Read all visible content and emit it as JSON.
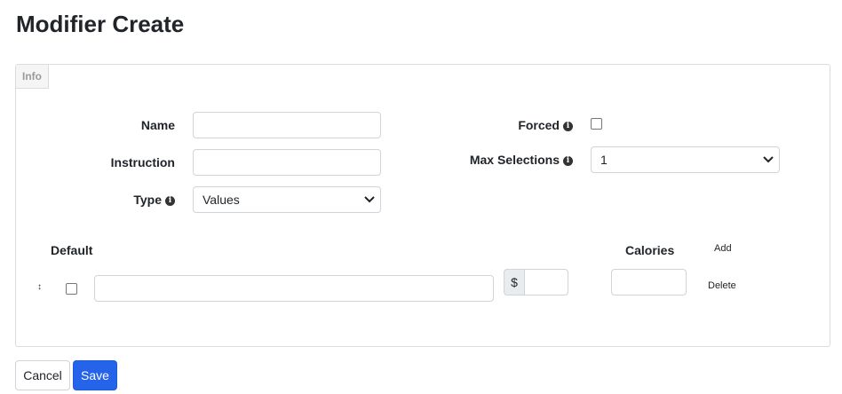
{
  "page": {
    "title": "Modifier Create"
  },
  "panel": {
    "tab_label": "Info"
  },
  "form": {
    "name_label": "Name",
    "name_value": "",
    "instruction_label": "Instruction",
    "instruction_value": "",
    "type_label": "Type",
    "type_value": "Values",
    "forced_label": "Forced",
    "forced_checked": false,
    "max_selections_label": "Max Selections",
    "max_selections_value": "1"
  },
  "values_table": {
    "default_header": "Default",
    "calories_header": "Calories",
    "add_label": "Add",
    "delete_label": "Delete",
    "currency_symbol": "$",
    "rows": [
      {
        "default_checked": false,
        "value": "",
        "price": "",
        "calories": ""
      }
    ]
  },
  "actions": {
    "cancel_label": "Cancel",
    "save_label": "Save"
  },
  "colors": {
    "primary": "#2563eb",
    "border": "#ced4da"
  },
  "icons": {
    "info": "info-circle-icon",
    "chevron": "chevron-down-icon",
    "sort": "sort-handle-icon"
  }
}
